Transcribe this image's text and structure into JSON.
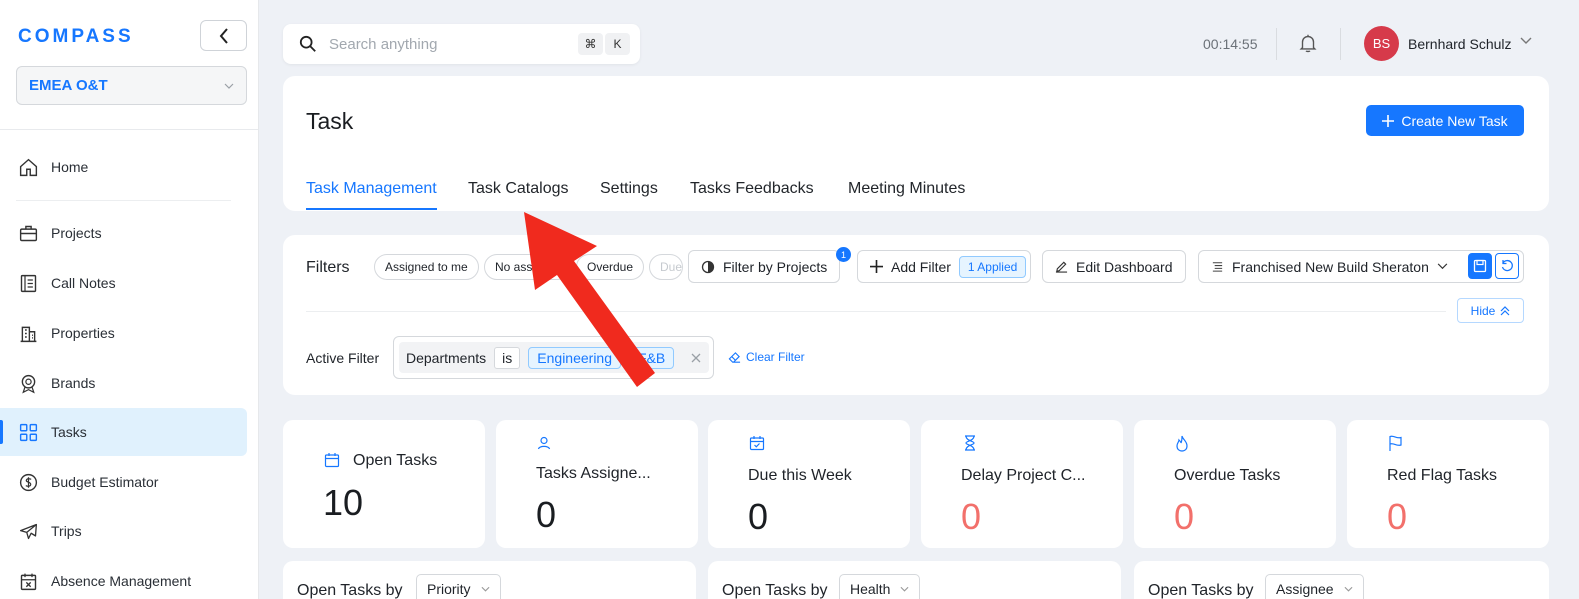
{
  "app": {
    "logo": "COMPASS",
    "org": "EMEA O&T"
  },
  "sidebar": {
    "items": [
      {
        "label": "Home",
        "icon": "home-icon"
      },
      {
        "label": "Projects",
        "icon": "briefcase-icon"
      },
      {
        "label": "Call Notes",
        "icon": "notes-icon"
      },
      {
        "label": "Properties",
        "icon": "building-icon"
      },
      {
        "label": "Brands",
        "icon": "brand-badge-icon"
      },
      {
        "label": "Tasks",
        "icon": "grid-icon",
        "active": true
      },
      {
        "label": "Budget Estimator",
        "icon": "dollar-icon"
      },
      {
        "label": "Trips",
        "icon": "plane-icon"
      },
      {
        "label": "Absence Management",
        "icon": "calendar-x-icon"
      }
    ]
  },
  "topbar": {
    "search_placeholder": "Search anything",
    "shortcut_cmd": "⌘",
    "shortcut_key": "K",
    "timer": "00:14:55",
    "user_initials": "BS",
    "user_name": "Bernhard Schulz"
  },
  "page": {
    "title": "Task",
    "create_button": "Create New Task",
    "tabs": [
      "Task Management",
      "Task Catalogs",
      "Settings",
      "Tasks Feedbacks",
      "Meeting Minutes"
    ],
    "active_tab": "Task Management"
  },
  "filters": {
    "label": "Filters",
    "quick_chips": [
      "Assigned to me",
      "No assi",
      "Overdue",
      "Due"
    ],
    "filter_by_projects": "Filter by Projects",
    "projects_badge": "1",
    "add_filter": "Add Filter",
    "applied": "1 Applied",
    "edit_dashboard": "Edit Dashboard",
    "dashboard_name": "Franchised New Build Sheraton",
    "hide": "Hide",
    "active_filter_label": "Active Filter",
    "active_filter": {
      "field": "Departments",
      "operator": "is",
      "values": [
        "Engineering",
        "F&B"
      ]
    },
    "clear_filter": "Clear Filter"
  },
  "stats": [
    {
      "label": "Open Tasks",
      "value": "10",
      "icon": "calendar-icon"
    },
    {
      "label": "Tasks Assigne...",
      "value": "0",
      "icon": "user-icon"
    },
    {
      "label": "Due this Week",
      "value": "0",
      "icon": "calendar-check-icon"
    },
    {
      "label": "Delay Project C...",
      "value": "0",
      "icon": "hourglass-icon",
      "alert": true
    },
    {
      "label": "Overdue Tasks",
      "value": "0",
      "icon": "flame-icon",
      "alert": true
    },
    {
      "label": "Red Flag Tasks",
      "value": "0",
      "icon": "flag-icon",
      "alert": true
    }
  ],
  "bottom_cards": [
    {
      "title": "Open Tasks by",
      "select": "Priority"
    },
    {
      "title": "Open Tasks by",
      "select": "Health"
    },
    {
      "title": "Open Tasks by",
      "select": "Assignee"
    }
  ],
  "colors": {
    "accent": "#1677ff",
    "alert": "#f2706b",
    "annotation_arrow": "#f02a1e"
  }
}
